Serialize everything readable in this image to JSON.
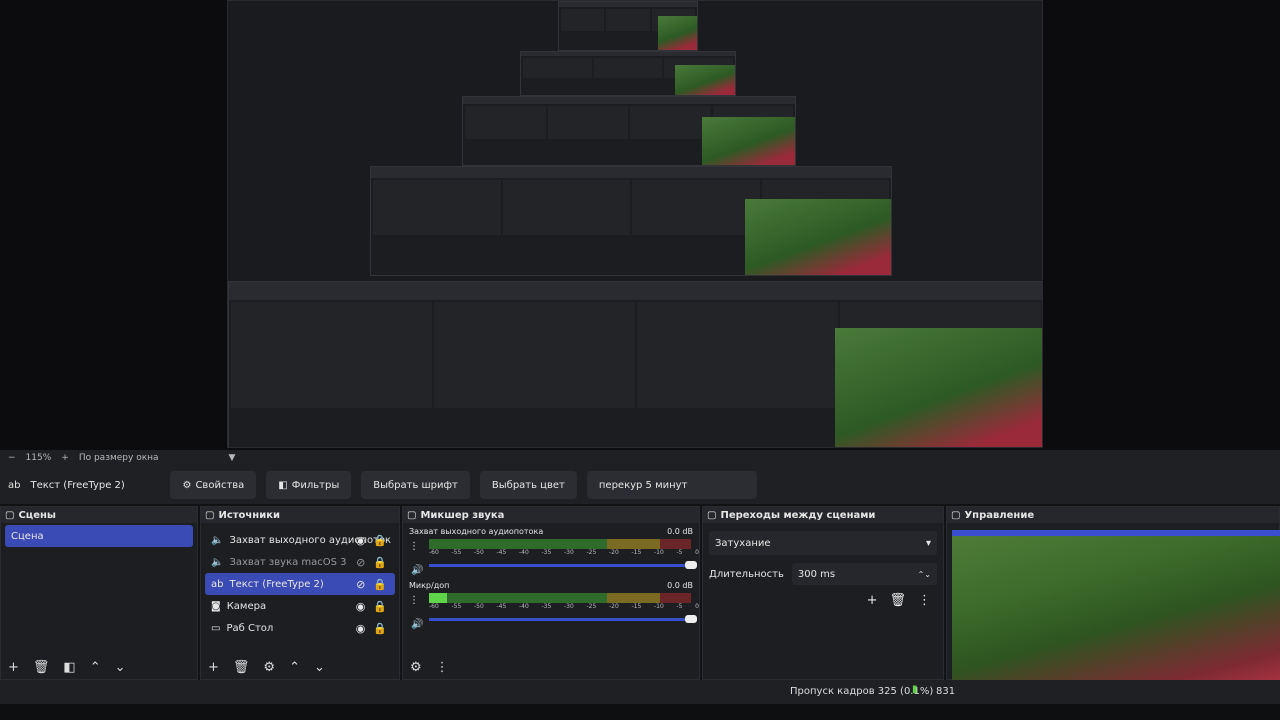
{
  "zoom": {
    "level": "115%",
    "fit_label": "По размеру окна"
  },
  "toolbar": {
    "source_name": "Текст (FreeType 2)",
    "properties": "Свойства",
    "filters": "Фильтры",
    "choose_font": "Выбрать шрифт",
    "choose_color": "Выбрать цвет",
    "text_value": "перекур 5 минут"
  },
  "scenes": {
    "title": "Сцены",
    "items": [
      "Сцена"
    ]
  },
  "sources": {
    "title": "Источники",
    "items": [
      {
        "label": "Захват выходного аудиопоток",
        "icon": "speaker-icon",
        "selected": false
      },
      {
        "label": "Захват звука macOS 3",
        "icon": "speaker-icon",
        "selected": false
      },
      {
        "label": "Текст (FreeType 2)",
        "icon": "text-icon",
        "selected": true
      },
      {
        "label": "Камера",
        "icon": "camera-icon",
        "selected": false
      },
      {
        "label": "Раб Стол",
        "icon": "display-icon",
        "selected": false
      }
    ]
  },
  "mixer": {
    "title": "Микшер звука",
    "channels": [
      {
        "name": "Захват выходного аудиопотока",
        "db": "0.0 dB",
        "level": 0.0
      },
      {
        "name": "Микр/доп",
        "db": "0.0 dB",
        "level": 0.05
      }
    ],
    "ticks": [
      "-60",
      "-55",
      "-50",
      "-45",
      "-40",
      "-35",
      "-30",
      "-25",
      "-20",
      "-15",
      "-10",
      "-5",
      "0"
    ]
  },
  "transitions": {
    "title": "Переходы между сценами",
    "selected": "Затухание",
    "duration_label": "Длительность",
    "duration_value": "300 ms"
  },
  "controls": {
    "title": "Управление"
  },
  "status": {
    "dropped_frames": "Пропуск кадров 325 (0.1%)",
    "extra": "831"
  },
  "colors": {
    "accent": "#3b4bb5",
    "slider": "#3a4fd0",
    "meter_green": "#2f6b2a",
    "meter_yellow": "#7a6a22",
    "meter_red": "#6b2428"
  }
}
